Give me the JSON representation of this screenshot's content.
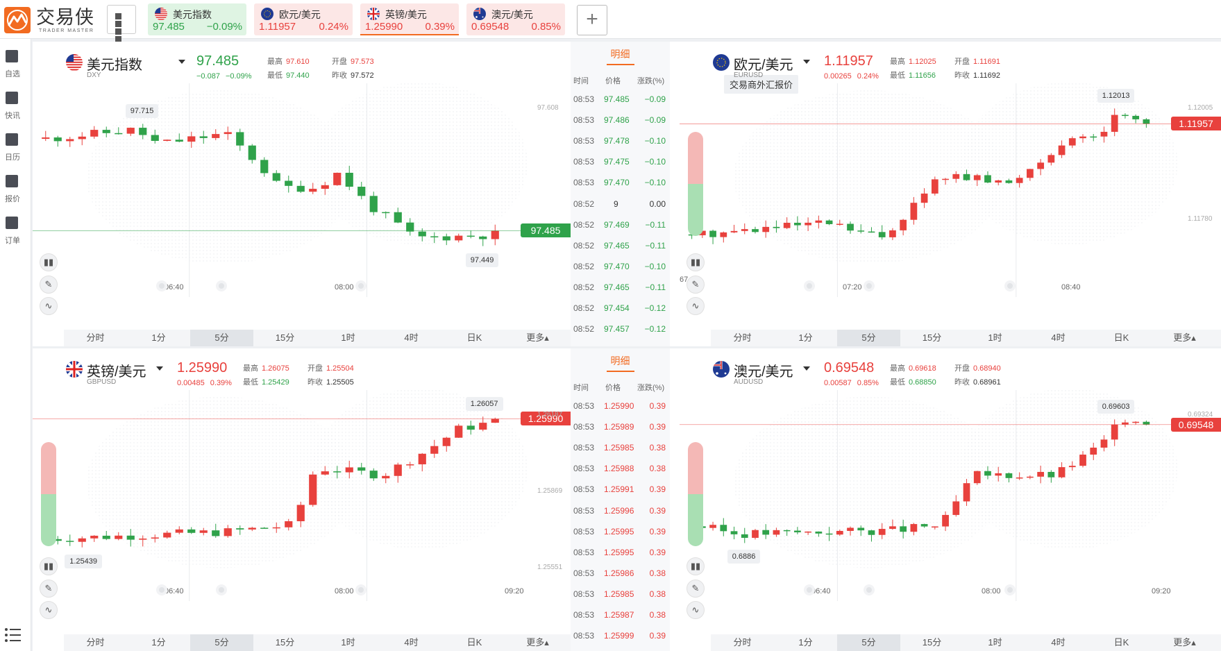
{
  "app": {
    "logo_cn": "交易侠",
    "logo_en": "TRADER MASTER"
  },
  "topbar": {
    "tabs": [
      {
        "name": "美元指数",
        "price": "97.485",
        "change": "−0.09%",
        "dir": "down",
        "flag": "us"
      },
      {
        "name": "欧元/美元",
        "price": "1.11957",
        "change": "0.24%",
        "dir": "up",
        "flag": "eu"
      },
      {
        "name": "英镑/美元",
        "price": "1.25990",
        "change": "0.39%",
        "dir": "up",
        "flag": "gb"
      },
      {
        "name": "澳元/美元",
        "price": "0.69548",
        "change": "0.85%",
        "dir": "up",
        "flag": "au"
      }
    ],
    "add_label": "+"
  },
  "sidebar": {
    "items": [
      {
        "label": "自选",
        "icon": "bookmark-plus-icon"
      },
      {
        "label": "快讯",
        "icon": "news-icon"
      },
      {
        "label": "日历",
        "icon": "calendar-icon"
      },
      {
        "label": "报价",
        "icon": "chart-line-icon"
      },
      {
        "label": "订单",
        "icon": "clipboard-icon"
      }
    ]
  },
  "colors": {
    "up": "#e8413d",
    "down": "#2fa24a",
    "accent": "#f26b21",
    "grid": "#e9ebee"
  },
  "timeframes": [
    "分时",
    "1分",
    "5分",
    "15分",
    "1时",
    "4时",
    "日K",
    "更多▴"
  ],
  "active_timeframe": "5分",
  "detail_labels": {
    "title": "明细",
    "time": "时间",
    "price": "价格",
    "change": "涨跌(%)"
  },
  "ohlc_labels": {
    "high": "最高",
    "open": "开盘",
    "low": "最低",
    "prev": "昨收"
  },
  "panels": [
    {
      "name": "美元指数",
      "code": "DXY",
      "price": "97.485",
      "dir": "down",
      "chg": "−0.087",
      "chg_pct": "−0.09%",
      "high": "97.610",
      "open": "97.573",
      "low": "97.440",
      "prev": "97.572",
      "max_label": "97.715",
      "min_label": "97.449",
      "price_tag": "97.485",
      "axis_labels": [
        "97.608"
      ],
      "time_labels": [
        "06:40",
        "08:00"
      ],
      "detail": [
        [
          "08:53",
          "97.485",
          "−0.09",
          "d"
        ],
        [
          "08:53",
          "97.486",
          "−0.09",
          "d"
        ],
        [
          "08:53",
          "97.478",
          "−0.10",
          "d"
        ],
        [
          "08:53",
          "97.475",
          "−0.10",
          "d"
        ],
        [
          "08:53",
          "97.470",
          "−0.10",
          "d"
        ],
        [
          "08:52",
          "9",
          "0.00",
          "n"
        ],
        [
          "08:52",
          "97.469",
          "−0.11",
          "d"
        ],
        [
          "08:52",
          "97.465",
          "−0.11",
          "d"
        ],
        [
          "08:52",
          "97.470",
          "−0.10",
          "d"
        ],
        [
          "08:52",
          "97.465",
          "−0.11",
          "d"
        ],
        [
          "08:52",
          "97.454",
          "−0.12",
          "d"
        ],
        [
          "08:52",
          "97.457",
          "−0.12",
          "d"
        ]
      ]
    },
    {
      "name": "欧元/美元",
      "code": "EURUSD",
      "price": "1.11957",
      "dir": "up",
      "chg": "0.00265",
      "chg_pct": "0.24%",
      "high": "1.12025",
      "open": "1.11691",
      "low": "1.11656",
      "prev": "1.11692",
      "max_label": "1.12013",
      "min_label": "",
      "price_tag": "1.11957",
      "axis_labels": [
        "1.12005",
        "1.11780"
      ],
      "time_labels": [
        "07:20",
        "08:40"
      ],
      "tooltip": "交易商外汇报价",
      "edge_label": "67"
    },
    {
      "name": "英镑/美元",
      "code": "GBPUSD",
      "price": "1.25990",
      "dir": "up",
      "chg": "0.00485",
      "chg_pct": "0.39%",
      "high": "1.26075",
      "open": "1.25504",
      "low": "1.25429",
      "prev": "1.25505",
      "max_label": "1.26057",
      "min_label": "1.25439",
      "price_tag": "1.25990",
      "axis_labels": [
        "1.26187",
        "1.25869",
        "1.25551"
      ],
      "time_labels": [
        "06:40",
        "08:00",
        "09:20"
      ],
      "detail": [
        [
          "08:53",
          "1.25990",
          "0.39",
          "u"
        ],
        [
          "08:53",
          "1.25989",
          "0.39",
          "u"
        ],
        [
          "08:53",
          "1.25985",
          "0.38",
          "u"
        ],
        [
          "08:53",
          "1.25988",
          "0.38",
          "u"
        ],
        [
          "08:53",
          "1.25991",
          "0.39",
          "u"
        ],
        [
          "08:53",
          "1.25996",
          "0.39",
          "u"
        ],
        [
          "08:53",
          "1.25995",
          "0.39",
          "u"
        ],
        [
          "08:53",
          "1.25995",
          "0.39",
          "u"
        ],
        [
          "08:53",
          "1.25986",
          "0.38",
          "u"
        ],
        [
          "08:53",
          "1.25985",
          "0.38",
          "u"
        ],
        [
          "08:53",
          "1.25987",
          "0.38",
          "u"
        ],
        [
          "08:53",
          "1.25999",
          "0.39",
          "u"
        ]
      ]
    },
    {
      "name": "澳元/美元",
      "code": "AUDUSD",
      "price": "0.69548",
      "dir": "up",
      "chg": "0.00587",
      "chg_pct": "0.85%",
      "high": "0.69618",
      "open": "0.68940",
      "low": "0.68850",
      "prev": "0.68961",
      "max_label": "0.69603",
      "min_label": "0.6886",
      "price_tag": "0.69548",
      "axis_labels": [
        "0.69324"
      ],
      "time_labels": [
        "06:40",
        "08:00",
        "09:20"
      ]
    }
  ]
}
